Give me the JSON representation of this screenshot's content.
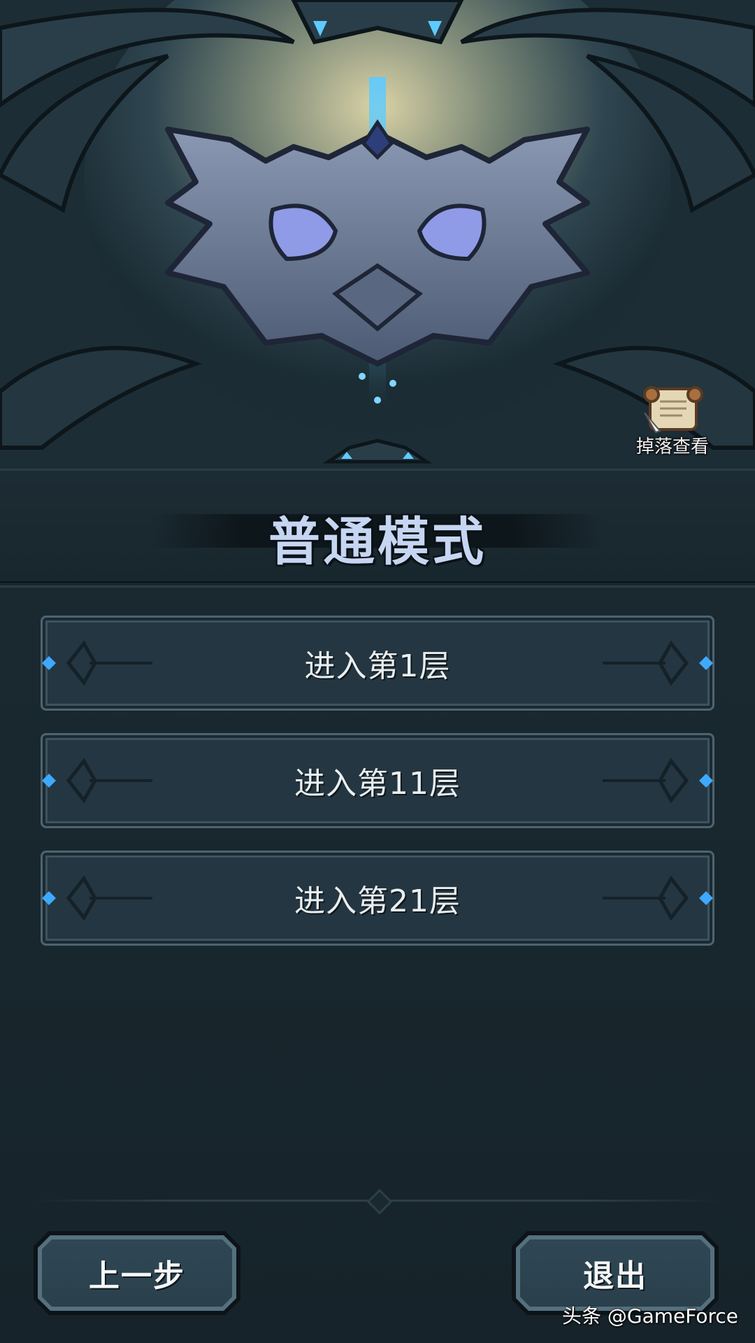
{
  "drop_view": {
    "label": "掉落查看",
    "icon": "scroll-icon"
  },
  "mode": {
    "title": "普通模式"
  },
  "floors": [
    {
      "label": "进入第1层"
    },
    {
      "label": "进入第11层"
    },
    {
      "label": "进入第21层"
    }
  ],
  "nav": {
    "back_label": "上一步",
    "exit_label": "退出"
  },
  "watermark": {
    "text": "头条 @GameForce"
  },
  "colors": {
    "background": "#16232a",
    "title_text": "#c6d5f2",
    "button_fill": "#243641",
    "accent_blue": "#3fa9ff"
  },
  "boss_emblem": {
    "icon": "demon-mask-icon"
  }
}
